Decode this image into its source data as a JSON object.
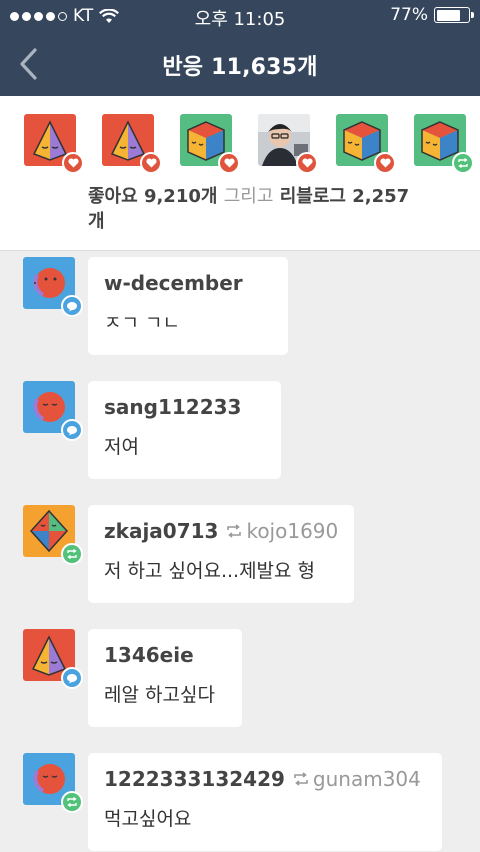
{
  "status": {
    "carrier": "KT",
    "time": "오후 11:05",
    "battery_pct": "77%",
    "battery_level": 0.77,
    "signal_bars_filled": 4
  },
  "header": {
    "title": "반응 11,635개"
  },
  "summary": {
    "likes": "좋아요 9,210개",
    "and": "그리고",
    "reblogs": "리블로그 2,257",
    "suffix": "개",
    "avatars": [
      {
        "type": "pyramid-orange",
        "badge": "heart"
      },
      {
        "type": "pyramid-orange",
        "badge": "heart"
      },
      {
        "type": "cube-green",
        "badge": "heart"
      },
      {
        "type": "photo-person",
        "badge": "heart"
      },
      {
        "type": "cube-green",
        "badge": "heart"
      },
      {
        "type": "cube-green",
        "badge": "reblog"
      }
    ]
  },
  "notes": [
    {
      "user": "w-december",
      "via": "",
      "text": "ㅈㄱ ㄱㄴ",
      "avatar": "face-blue",
      "badge": "reply"
    },
    {
      "user": "sang112233",
      "via": "",
      "text": "저여",
      "avatar": "face-blue",
      "badge": "reply"
    },
    {
      "user": "zkaja0713",
      "via": "kojo1690",
      "text": "저 하고 싶어요...제발요 형",
      "avatar": "diamond-orange",
      "badge": "reblog"
    },
    {
      "user": "1346eie",
      "via": "",
      "text": "레알 하고싶다",
      "avatar": "pyramid-red",
      "badge": "reply"
    },
    {
      "user": "1222333132429",
      "via": "gunam304",
      "text": "먹고싶어요",
      "avatar": "face-blue",
      "badge": "reblog"
    }
  ],
  "colors": {
    "header_bg": "#36465d",
    "like": "#e0533c",
    "reblog": "#52c17a",
    "reply": "#4aa3de"
  }
}
